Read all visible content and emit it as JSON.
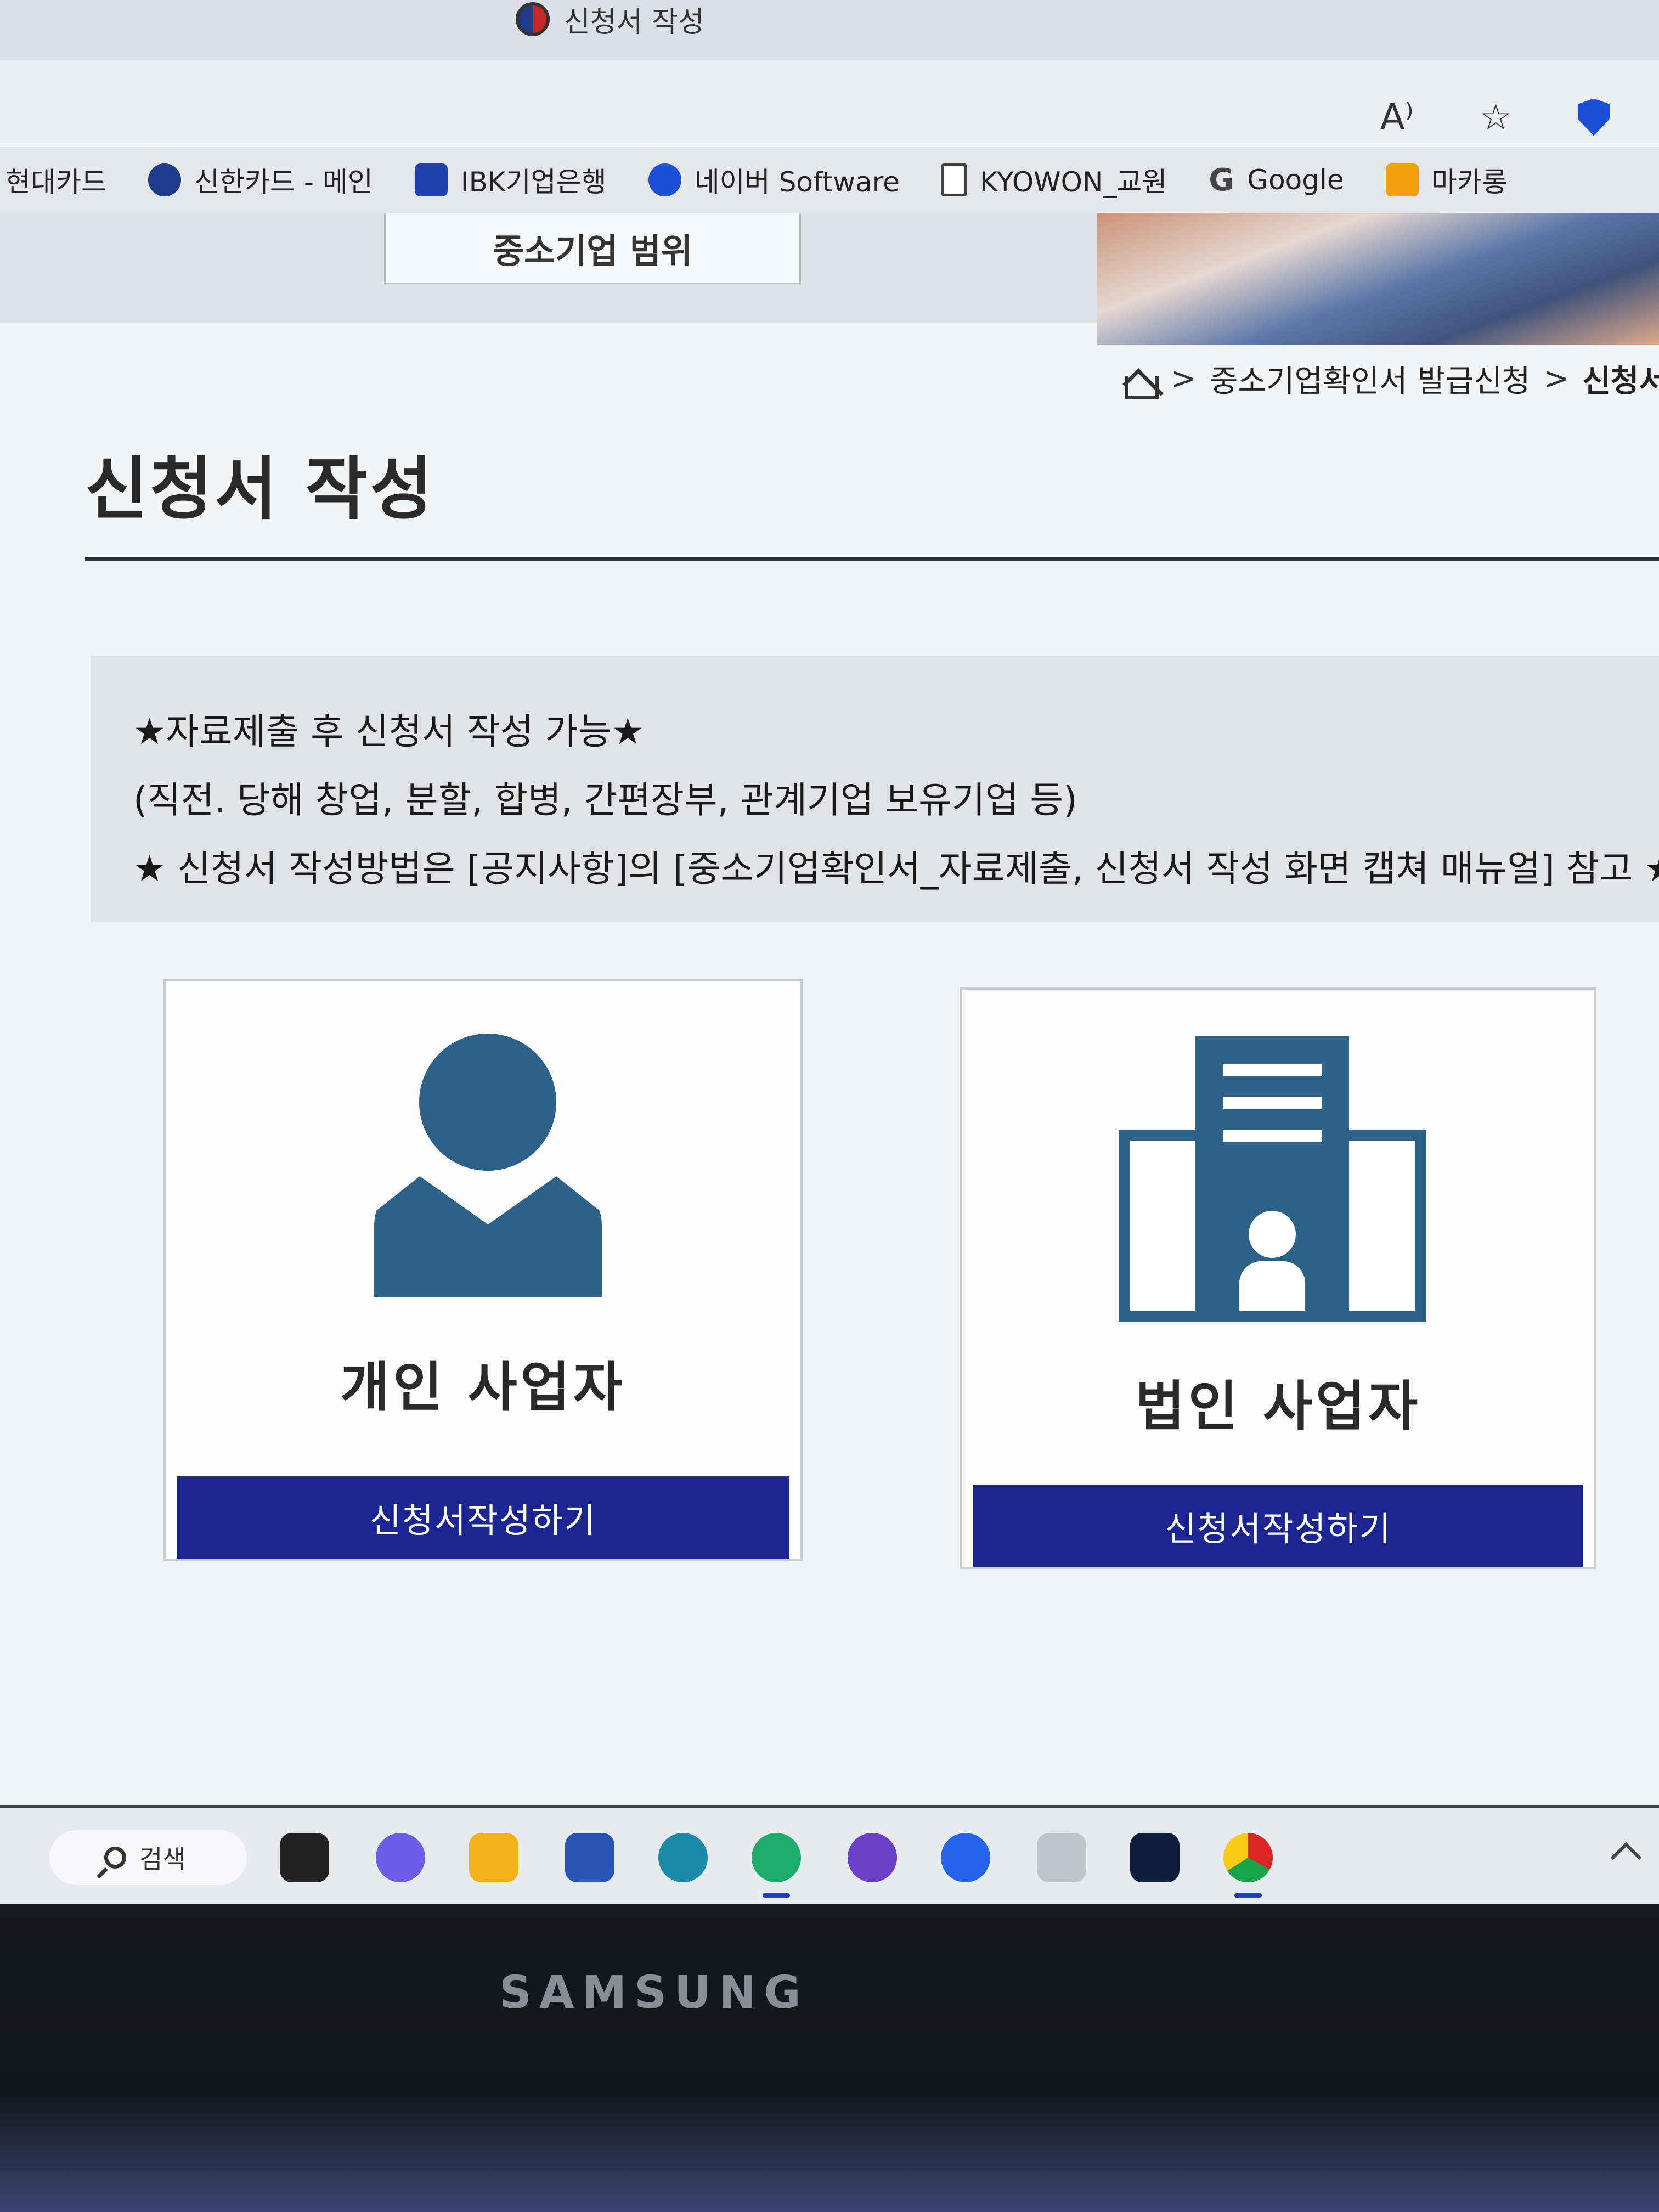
{
  "browser": {
    "tab_title": "신청서 작성",
    "bookmarks": [
      {
        "label": "현대카드",
        "icon": "card-icon"
      },
      {
        "label": "신한카드 - 메인",
        "icon": "shinhan-icon"
      },
      {
        "label": "IBK기업은행",
        "icon": "ibk-icon"
      },
      {
        "label": "네이버 Software",
        "icon": "download-icon"
      },
      {
        "label": "KYOWON_교원",
        "icon": "document-icon"
      },
      {
        "label": "Google",
        "icon": "google-icon"
      },
      {
        "label": "마카롱",
        "icon": "blogger-icon"
      }
    ]
  },
  "site": {
    "range_label": "중소기업 범위"
  },
  "breadcrumb": {
    "items": [
      "중소기업확인서 발급신청",
      "신청서작"
    ]
  },
  "page": {
    "title": "신청서 작성",
    "notice": {
      "line1": "★자료제출 후 신청서 작성 가능★",
      "line2": "(직전. 당해 창업, 분할, 합병, 간편장부, 관계기업 보유기업 등)",
      "line3": "★ 신청서 작성방법은 [공지사항]의 [중소기업확인서_자료제출, 신청서 작성 화면 캡쳐 매뉴얼] 참고 ★"
    },
    "cards": [
      {
        "label": "개인 사업자",
        "button": "신청서작성하기"
      },
      {
        "label": "법인 사업자",
        "button": "신청서작성하기"
      }
    ]
  },
  "taskbar": {
    "search_label": "검색"
  },
  "device": {
    "brand": "SAMSUNG"
  },
  "colors": {
    "primary_button": "#1a2592",
    "icon_blue": "#2d6288"
  }
}
